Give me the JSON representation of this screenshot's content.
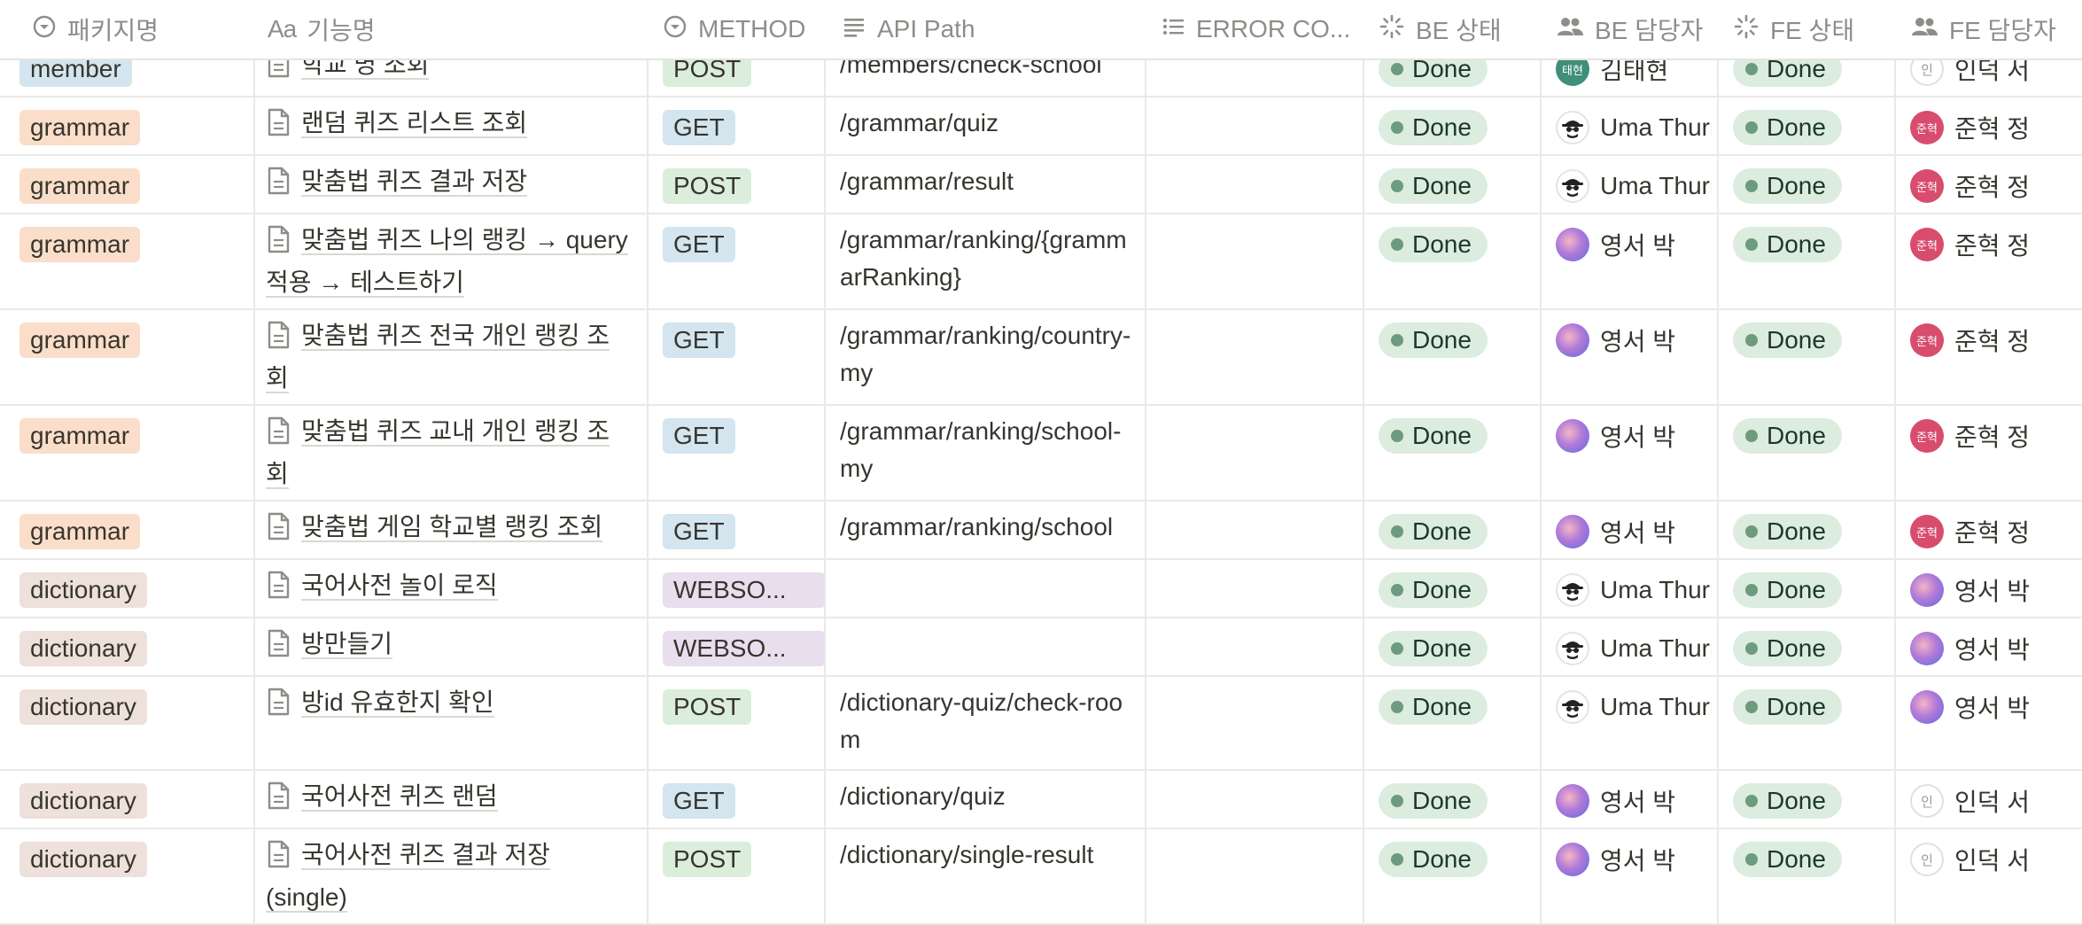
{
  "columns": {
    "package": "패키지명",
    "feature": "기능명",
    "feature_prefix": "Aa",
    "method": "METHOD",
    "path": "API Path",
    "error": "ERROR CO...",
    "be_status": "BE 상태",
    "be_owner": "BE 담당자",
    "fe_status": "FE 상태",
    "fe_owner": "FE 담당자"
  },
  "colors": {
    "member_tag": "#d3e5ef",
    "grammar_tag": "#fadec9",
    "dictionary_tag": "#eee0da",
    "get_tag": "#d3e5ef",
    "post_tag": "#dbeddb",
    "websocket_tag": "#e8deee",
    "status_bg": "#dcecdf",
    "status_dot": "#6c9b7d"
  },
  "rows": [
    {
      "package": "member",
      "package_kind": "member",
      "feature": "학교 명 조회",
      "method": "POST",
      "path": "/members/check-school",
      "be_status": "Done",
      "be_owner": "김태현",
      "be_avatar": "teal",
      "be_avatar_text": "태현",
      "fe_status": "Done",
      "fe_owner": "인덕 서",
      "fe_avatar": "light",
      "fe_avatar_text": "인"
    },
    {
      "package": "grammar",
      "package_kind": "grammar",
      "feature": "랜덤 퀴즈 리스트 조회",
      "method": "GET",
      "path": "/grammar/quiz",
      "be_status": "Done",
      "be_owner": "Uma Thurman",
      "be_avatar": "spy",
      "be_avatar_text": "",
      "fe_status": "Done",
      "fe_owner": "준혁 정",
      "fe_avatar": "red",
      "fe_avatar_text": "준혁"
    },
    {
      "package": "grammar",
      "package_kind": "grammar",
      "feature": "맞춤법 퀴즈 결과 저장",
      "method": "POST",
      "path": "/grammar/result",
      "be_status": "Done",
      "be_owner": "Uma Thurman",
      "be_avatar": "spy",
      "be_avatar_text": "",
      "fe_status": "Done",
      "fe_owner": "준혁 정",
      "fe_avatar": "red",
      "fe_avatar_text": "준혁"
    },
    {
      "package": "grammar",
      "package_kind": "grammar",
      "feature": "맞춤법 퀴즈 나의 랭킹 → query 적용 → 테스트하기",
      "method": "GET",
      "path": "/grammar/ranking/{grammarRanking}",
      "be_status": "Done",
      "be_owner": "영서 박",
      "be_avatar": "purple",
      "be_avatar_text": "",
      "fe_status": "Done",
      "fe_owner": "준혁 정",
      "fe_avatar": "red",
      "fe_avatar_text": "준혁"
    },
    {
      "package": "grammar",
      "package_kind": "grammar",
      "feature": "맞춤법 퀴즈 전국 개인 랭킹 조회",
      "method": "GET",
      "path": "/grammar/ranking/country-my",
      "be_status": "Done",
      "be_owner": "영서 박",
      "be_avatar": "purple",
      "be_avatar_text": "",
      "fe_status": "Done",
      "fe_owner": "준혁 정",
      "fe_avatar": "red",
      "fe_avatar_text": "준혁"
    },
    {
      "package": "grammar",
      "package_kind": "grammar",
      "feature": "맞춤법 퀴즈 교내 개인 랭킹 조회",
      "method": "GET",
      "path": "/grammar/ranking/school-my",
      "be_status": "Done",
      "be_owner": "영서 박",
      "be_avatar": "purple",
      "be_avatar_text": "",
      "fe_status": "Done",
      "fe_owner": "준혁 정",
      "fe_avatar": "red",
      "fe_avatar_text": "준혁"
    },
    {
      "package": "grammar",
      "package_kind": "grammar",
      "feature": "맞춤법 게임 학교별 랭킹 조회",
      "method": "GET",
      "path": "/grammar/ranking/school",
      "be_status": "Done",
      "be_owner": "영서 박",
      "be_avatar": "purple",
      "be_avatar_text": "",
      "fe_status": "Done",
      "fe_owner": "준혁 정",
      "fe_avatar": "red",
      "fe_avatar_text": "준혁"
    },
    {
      "package": "dictionary",
      "package_kind": "dictionary",
      "feature": "국어사전 놀이 로직",
      "method": "WEBSO...",
      "path": "",
      "be_status": "Done",
      "be_owner": "Uma Thurman",
      "be_avatar": "spy",
      "be_avatar_text": "",
      "fe_status": "Done",
      "fe_owner": "영서 박",
      "fe_avatar": "purple",
      "fe_avatar_text": ""
    },
    {
      "package": "dictionary",
      "package_kind": "dictionary",
      "feature": "방만들기",
      "method": "WEBSO...",
      "path": "",
      "be_status": "Done",
      "be_owner": "Uma Thurman",
      "be_avatar": "spy",
      "be_avatar_text": "",
      "fe_status": "Done",
      "fe_owner": "영서 박",
      "fe_avatar": "purple",
      "fe_avatar_text": ""
    },
    {
      "package": "dictionary",
      "package_kind": "dictionary",
      "feature": "방id 유효한지 확인",
      "method": "POST",
      "path": "/dictionary-quiz/check-room",
      "be_status": "Done",
      "be_owner": "Uma Thurman",
      "be_avatar": "spy",
      "be_avatar_text": "",
      "fe_status": "Done",
      "fe_owner": "영서 박",
      "fe_avatar": "purple",
      "fe_avatar_text": ""
    },
    {
      "package": "dictionary",
      "package_kind": "dictionary",
      "feature": "국어사전 퀴즈 랜덤",
      "method": "GET",
      "path": "/dictionary/quiz",
      "be_status": "Done",
      "be_owner": "영서 박",
      "be_avatar": "purple",
      "be_avatar_text": "",
      "fe_status": "Done",
      "fe_owner": "인덕 서",
      "fe_avatar": "light",
      "fe_avatar_text": "인"
    },
    {
      "package": "dictionary",
      "package_kind": "dictionary",
      "feature": "국어사전 퀴즈 결과 저장 (single)",
      "method": "POST",
      "path": "/dictionary/single-result",
      "be_status": "Done",
      "be_owner": "영서 박",
      "be_avatar": "purple",
      "be_avatar_text": "",
      "fe_status": "Done",
      "fe_owner": "인덕 서",
      "fe_avatar": "light",
      "fe_avatar_text": "인"
    }
  ]
}
